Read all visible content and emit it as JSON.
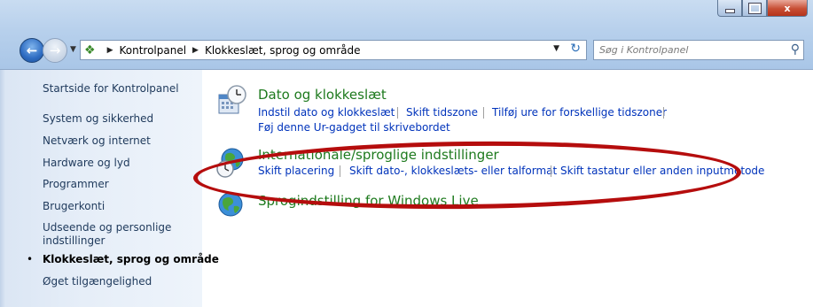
{
  "window": {
    "minimize_icon": "minimize-icon",
    "maximize_icon": "maximize-icon",
    "close_icon": "close-icon",
    "close_label": "x"
  },
  "address_bar": {
    "breadcrumbs": [
      "Kontrolpanel",
      "Klokkeslæt, sprog og område"
    ],
    "search_placeholder": "Søg i Kontrolpanel"
  },
  "sidebar": {
    "home": "Startside for Kontrolpanel",
    "items": [
      "System og sikkerhed",
      "Netværk og internet",
      "Hardware og lyd",
      "Programmer",
      "Brugerkonti",
      "Udseende og personlige",
      "indstillinger",
      "Klokkeslæt, sprog og område",
      "Øget tilgængelighed"
    ],
    "current_bullet": "•"
  },
  "main": {
    "categories": [
      {
        "title": "Dato og klokkeslæt",
        "icon": "clock-calendar-icon",
        "links": [
          "Indstil dato og klokkeslæt",
          "Skift tidszone",
          "Tilføj ure for forskellige tidszoner",
          "Føj denne Ur-gadget til skrivebordet"
        ]
      },
      {
        "title": "Internationale/sproglige indstillinger",
        "icon": "globe-clock-icon",
        "links": [
          "Skift placering",
          "Skift dato-, klokkeslæts- eller talformat",
          "Skift tastatur eller anden inputmetode"
        ]
      },
      {
        "title": "Sprogindstilling for Windows Live",
        "icon": "globe-icon",
        "links": []
      }
    ]
  },
  "colors": {
    "category_title": "#1e7a1e",
    "link": "#0033bb",
    "annotation": "#b50d0d"
  }
}
